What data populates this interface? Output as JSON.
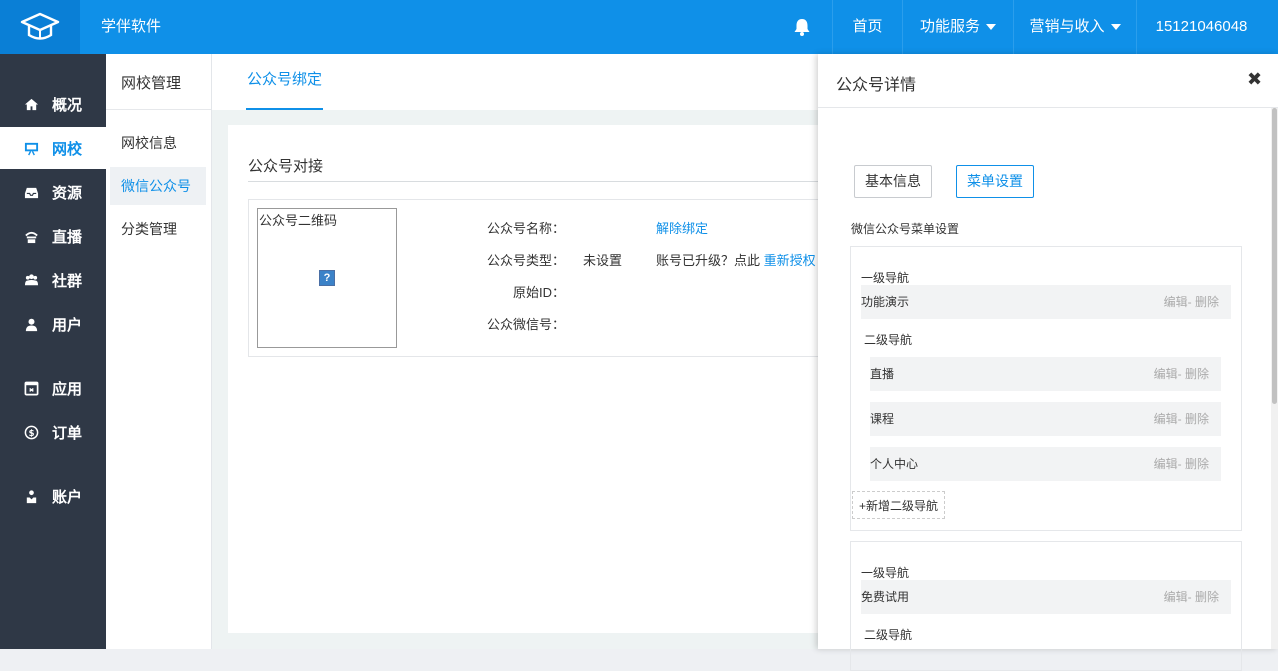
{
  "header": {
    "app_name": "学伴软件",
    "nav": [
      {
        "label": "首页",
        "dropdown": false
      },
      {
        "label": "功能服务",
        "dropdown": true
      },
      {
        "label": "营销与收入",
        "dropdown": true
      },
      {
        "label": "15121046048",
        "dropdown": false
      }
    ],
    "icons": [
      "graduation-cap-logo-icon",
      "bell-icon"
    ]
  },
  "sidebar": {
    "items": [
      {
        "label": "概况",
        "icon": "home-icon",
        "active": false
      },
      {
        "label": "网校",
        "icon": "presentation-icon",
        "active": true
      },
      {
        "label": "资源",
        "icon": "inbox-icon",
        "active": false
      },
      {
        "label": "直播",
        "icon": "broadcast-icon",
        "active": false
      },
      {
        "label": "社群",
        "icon": "users-icon",
        "active": false
      },
      {
        "label": "用户",
        "icon": "user-icon",
        "active": false
      },
      {
        "label": "应用",
        "icon": "app-icon",
        "active": false
      },
      {
        "label": "订单",
        "icon": "dollar-icon",
        "active": false
      },
      {
        "label": "账户",
        "icon": "account-icon",
        "active": false
      }
    ]
  },
  "subnav": {
    "title": "网校管理",
    "items": [
      {
        "label": "网校信息",
        "active": false
      },
      {
        "label": "微信公众号",
        "active": true
      },
      {
        "label": "分类管理",
        "active": false
      }
    ]
  },
  "main": {
    "tab": "公众号绑定",
    "card_title": "公众号对接",
    "qr_label": "公众号二维码",
    "fields": {
      "name_label": "公众号名称：",
      "type_label": "公众号类型：",
      "type_value": "未设置",
      "origin_label": "原始ID：",
      "wechat_label": "公众微信号：",
      "unbind_link": "解除绑定",
      "upgrade_text": "账号已升级？点此",
      "reauth_link": "重新授权"
    }
  },
  "drawer": {
    "title": "公众号详情",
    "buttons": [
      {
        "label": "基本信息",
        "active": false
      },
      {
        "label": "菜单设置",
        "active": true
      }
    ],
    "section_label": "微信公众号菜单设置",
    "level1_label": "一级导航",
    "level2_label": "二级导航",
    "edit_label": "编辑",
    "delete_label": "- 删除",
    "add_sub_label": "+新增二级导航",
    "groups": [
      {
        "name": "功能演示",
        "subs": [
          "直播",
          "课程",
          "个人中心"
        ]
      },
      {
        "name": "免费试用",
        "subs": []
      }
    ]
  },
  "colors": {
    "primary": "#0f90e8",
    "sidebar_bg": "#2f3846",
    "row_bg": "#f2f3f4"
  }
}
